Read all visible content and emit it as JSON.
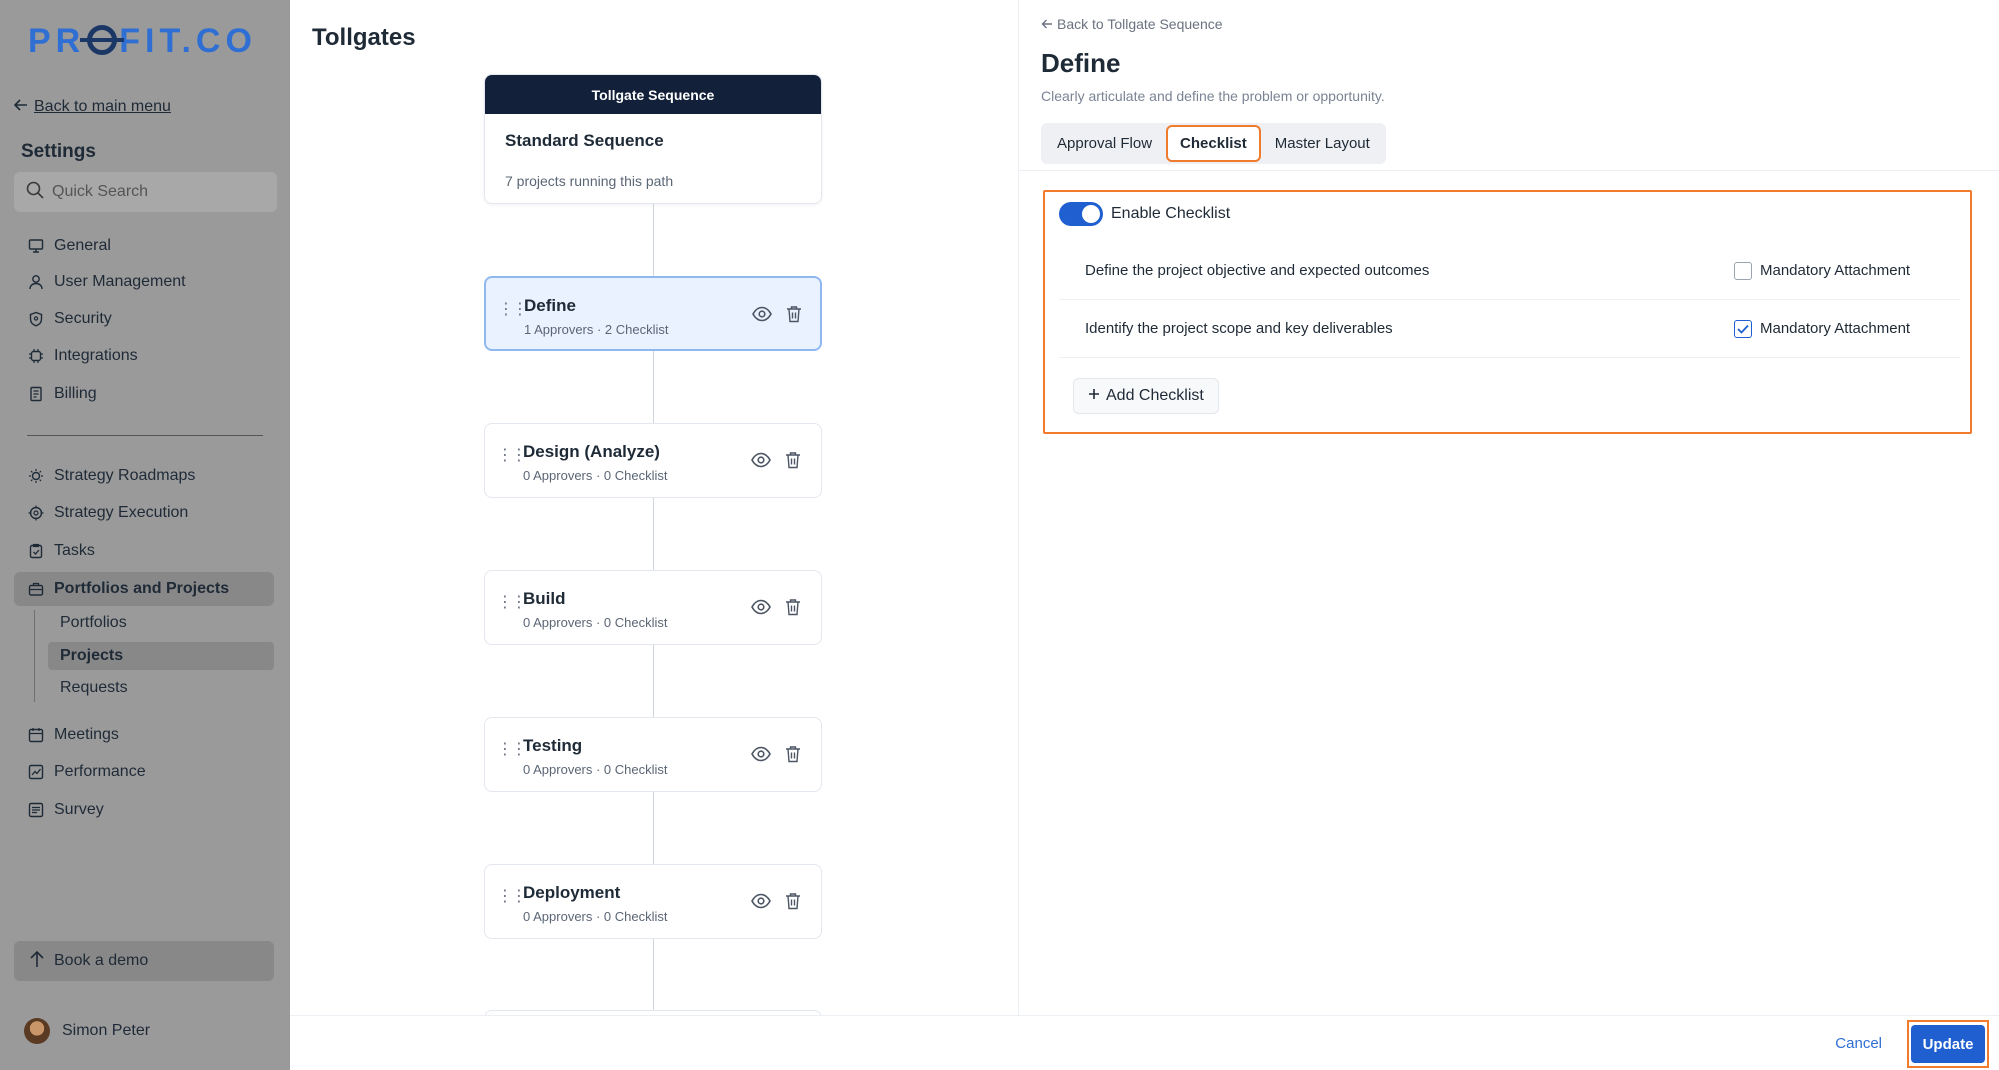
{
  "brand": {
    "logo_pre": "PR",
    "logo_post": "FIT.CO",
    "accent": "#2f6fd3",
    "dark": "#1b3765"
  },
  "sidebar": {
    "back_label": "Back to main menu",
    "settings_title": "Settings",
    "search_placeholder": "Quick Search",
    "group1": [
      {
        "label": "General",
        "icon": "monitor-icon"
      },
      {
        "label": "User Management",
        "icon": "user-icon"
      },
      {
        "label": "Security",
        "icon": "shield-icon"
      },
      {
        "label": "Integrations",
        "icon": "plug-icon"
      },
      {
        "label": "Billing",
        "icon": "receipt-icon"
      }
    ],
    "group2": [
      {
        "label": "Strategy Roadmaps",
        "icon": "bulb-icon"
      },
      {
        "label": "Strategy Execution",
        "icon": "target-icon"
      },
      {
        "label": "Tasks",
        "icon": "clipboard-icon"
      },
      {
        "label": "Portfolios and Projects",
        "icon": "briefcase-icon"
      }
    ],
    "sub_items": [
      "Portfolios",
      "Projects",
      "Requests"
    ],
    "group3": [
      {
        "label": "Meetings",
        "icon": "calendar-icon"
      },
      {
        "label": "Performance",
        "icon": "chart-icon"
      },
      {
        "label": "Survey",
        "icon": "list-icon"
      }
    ],
    "book_demo": "Book a demo",
    "user_name": "Simon Peter"
  },
  "middle": {
    "title": "Tollgates",
    "sequence": {
      "header": "Tollgate Sequence",
      "name": "Standard Sequence",
      "subtitle": "7 projects running this path"
    },
    "stages": [
      {
        "name": "Define",
        "meta": "1 Approvers · 2 Checklist"
      },
      {
        "name": "Design (Analyze)",
        "meta": "0 Approvers · 0 Checklist"
      },
      {
        "name": "Build",
        "meta": "0 Approvers · 0 Checklist"
      },
      {
        "name": "Testing",
        "meta": "0 Approvers · 0 Checklist"
      },
      {
        "name": "Deployment",
        "meta": "0 Approvers · 0 Checklist"
      }
    ]
  },
  "detail": {
    "back_label": "Back to Tollgate Sequence",
    "title": "Define",
    "description": "Clearly articulate and define the problem or opportunity.",
    "tabs": [
      "Approval Flow",
      "Checklist",
      "Master Layout"
    ],
    "enable_label": "Enable Checklist",
    "checklist": [
      {
        "text": "Define the project objective and expected outcomes",
        "mandatory_label": "Mandatory Attachment"
      },
      {
        "text": "Identify the project scope and key deliverables",
        "mandatory_label": "Mandatory Attachment"
      }
    ],
    "add_label": "Add Checklist"
  },
  "footer": {
    "cancel": "Cancel",
    "update": "Update"
  }
}
